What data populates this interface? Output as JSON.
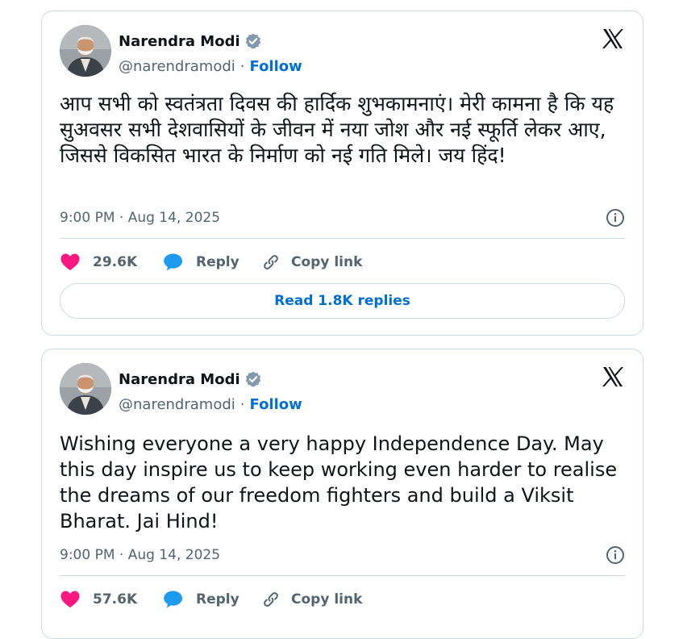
{
  "colors": {
    "link_blue": "#006fd6",
    "like_pink": "#f91880",
    "reply_blue": "#1d9bf0",
    "muted_gray": "#536471",
    "border_gray": "#cfd9de"
  },
  "tweets": [
    {
      "author": {
        "name": "Narendra Modi",
        "handle": "@narendramodi",
        "verified_icon": "verified-badge-icon",
        "follow_label": "Follow",
        "dot": "·"
      },
      "platform_icon": "x-logo-icon",
      "text": "आप सभी को स्वतंत्रता दिवस की हार्दिक शुभकामनाएं। मेरी कामना है कि यह सुअवसर सभी देशवासियों के जीवन में नया जोश और नई स्फूर्ति लेकर आए, जिससे विकसित भारत के निर्माण को नई गति मिले। जय हिंद!",
      "timestamp": "9:00 PM · Aug 14, 2025",
      "info_icon": "info-icon",
      "actions": {
        "likes": "29.6K",
        "reply_label": "Reply",
        "copy_label": "Copy link"
      },
      "read_replies_label": "Read 1.8K replies"
    },
    {
      "author": {
        "name": "Narendra Modi",
        "handle": "@narendramodi",
        "verified_icon": "verified-badge-icon",
        "follow_label": "Follow",
        "dot": "·"
      },
      "platform_icon": "x-logo-icon",
      "text": "Wishing everyone a very happy Independence Day. May this day inspire us to keep working even harder to realise the dreams of our freedom fighters and build a Viksit Bharat. Jai Hind!",
      "timestamp": "9:00 PM · Aug 14, 2025",
      "info_icon": "info-icon",
      "actions": {
        "likes": "57.6K",
        "reply_label": "Reply",
        "copy_label": "Copy link"
      }
    }
  ]
}
